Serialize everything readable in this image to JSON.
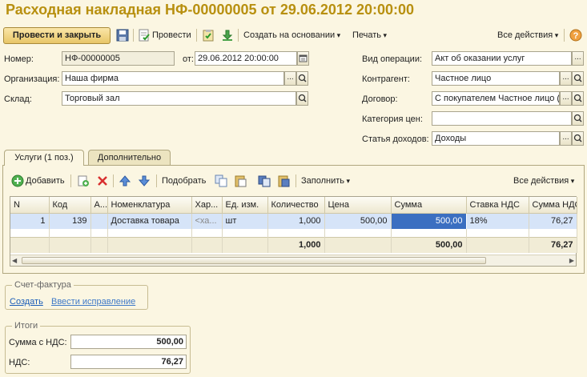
{
  "title": "Расходная накладная НФ-00000005 от 29.06.2012 20:00:00",
  "toolbar": {
    "post_close": "Провести и закрыть",
    "post": "Провести",
    "create_based": "Создать на основании",
    "print": "Печать",
    "all_actions": "Все действия",
    "help": "?"
  },
  "header": {
    "number_label": "Номер:",
    "number_value": "НФ-00000005",
    "date_label": "от:",
    "date_value": "29.06.2012 20:00:00",
    "org_label": "Организация:",
    "org_value": "Наша фирма",
    "warehouse_label": "Склад:",
    "warehouse_value": "Торговый зал",
    "operation_label": "Вид операции:",
    "operation_value": "Акт об оказании услуг",
    "contractor_label": "Контрагент:",
    "contractor_value": "Частное лицо",
    "contract_label": "Договор:",
    "contract_value": "С покупателем Частное лицо (...",
    "price_cat_label": "Категория цен:",
    "price_cat_value": "",
    "income_label": "Статья доходов:",
    "income_value": "Доходы"
  },
  "tabs": [
    {
      "label": "Услуги (1 поз.)",
      "active": true
    },
    {
      "label": "Дополнительно",
      "active": false
    }
  ],
  "grid_toolbar": {
    "add": "Добавить",
    "pick": "Подобрать",
    "fill": "Заполнить",
    "all_actions": "Все действия"
  },
  "table": {
    "columns": [
      "N",
      "Код",
      "А...",
      "Номенклатура",
      "Хар...",
      "Ед. изм.",
      "Количество",
      "Цена",
      "Сумма",
      "Ставка НДС",
      "Сумма НДС"
    ],
    "rows": [
      [
        "1",
        "139",
        "",
        "Доставка товара",
        "<ха...",
        "шт",
        "1,000",
        "500,00",
        "500,00",
        "18%",
        "76,27"
      ]
    ],
    "totals": {
      "quantity": "1,000",
      "sum": "500,00",
      "vat_sum": "76,27"
    }
  },
  "invoice": {
    "title": "Счет-фактура",
    "create": "Создать",
    "correction": "Ввести исправление"
  },
  "totals": {
    "title": "Итоги",
    "sum_vat_label": "Сумма с НДС:",
    "sum_vat_value": "500,00",
    "vat_label": "НДС:",
    "vat_value": "76,27"
  },
  "icons": {
    "save": "floppy-icon",
    "post": "post-doc-icon",
    "add": "plus-circle-icon",
    "delete": "red-x-icon",
    "up": "arrow-up-icon",
    "down": "arrow-down-icon"
  }
}
